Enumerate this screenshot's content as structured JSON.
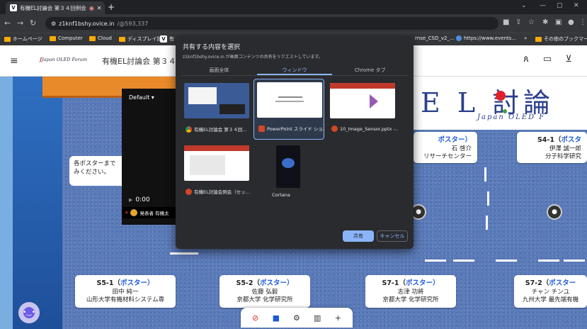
{
  "browser": {
    "tab_title": "有機EL討論会 第３４回例会",
    "url_host": "z1knf1bshy.ovice.in",
    "url_path": "/@593,337",
    "bookmarks": [
      "ホームページ",
      "Computer",
      "Cloud",
      "ディスプレイ技術",
      "有",
      "rnse_CSD_v2_...",
      "https://www.events...",
      "»",
      "その他のブックマーク"
    ]
  },
  "app": {
    "logo_text": "Japan OLED Forum",
    "title": "有機EL討論会 第３４回例"
  },
  "video": {
    "quality": "Default",
    "time": "0:00",
    "presenter": "発表者 有機太"
  },
  "note": {
    "text": "各ポスターまで\nみください。"
  },
  "banner": {
    "title": "E L 討論",
    "subtitle": "Japan OLED F"
  },
  "posters": [
    {
      "id": "S3-x",
      "title_prefix": "",
      "title_suffix": "ポスター）",
      "line1": "石 啓介",
      "line2": "リサーチセンター"
    },
    {
      "id": "S4-1",
      "title_prefix": "S4-1（",
      "title_suffix": "ポスタ",
      "line1": "伊澤 誠一郎",
      "line2": "分子科学研究"
    },
    {
      "id": "S5-1",
      "title_prefix": "S5-1（",
      "title_suffix": "ポスター）",
      "line1": "田中 純一",
      "line2": "山形大学有機材料システム専"
    },
    {
      "id": "S5-2",
      "title_prefix": "S5-2（",
      "title_suffix": "ポスター）",
      "line1": "佐藤 弘毅",
      "line2": "京都大学 化学研究所"
    },
    {
      "id": "S7-1",
      "title_prefix": "S7-1（",
      "title_suffix": "ポスター）",
      "line1": "志津 功將",
      "line2": "京都大学 化学研究所"
    },
    {
      "id": "S7-2",
      "title_prefix": "S7-2（",
      "title_suffix": "ポスター",
      "line1": "チャン チンユ",
      "line2": "九州大学 最先端有機"
    }
  ],
  "dialog": {
    "title": "共有する内容を選択",
    "description": "z1knf1bshy.ovice.in が画面コンテンツの共有をリクエストしています。",
    "tabs": [
      "画面全体",
      "ウィンドウ",
      "Chrome タブ"
    ],
    "windows": [
      {
        "label": "有機EL討論会 第３４回...",
        "icon": "chrome-icon"
      },
      {
        "label": "PowerPoint スライド ショ...",
        "icon": "powerpoint-icon"
      },
      {
        "label": "10_Image_Sensor.pptx -...",
        "icon": "powerpoint-icon"
      },
      {
        "label": "有機EL討論会例会（セッ...",
        "icon": "powerpoint-icon"
      },
      {
        "label": "Cortana",
        "icon": ""
      }
    ],
    "share_label": "共有",
    "cancel_label": "キャンセル"
  }
}
